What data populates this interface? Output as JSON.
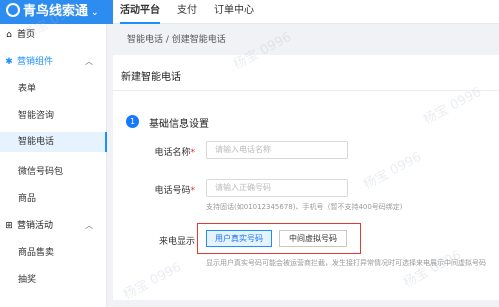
{
  "header": {
    "logo_text": "青鸟线索通",
    "logo_chevron": "⌄",
    "nav": [
      {
        "label": "活动平台",
        "active": true
      },
      {
        "label": "支付"
      },
      {
        "label": "订单中心"
      }
    ]
  },
  "sidebar": {
    "items": [
      {
        "label": "首页",
        "icon": "home-icon",
        "glyph": "⌂"
      },
      {
        "label": "营销组件",
        "icon": "component-icon",
        "glyph": "✱",
        "arrow": "︿"
      },
      {
        "label": "表单"
      },
      {
        "label": "智能咨询"
      },
      {
        "label": "智能电话"
      },
      {
        "label": "微信号码包"
      },
      {
        "label": "商品"
      },
      {
        "label": "营销活动",
        "icon": "activity-icon",
        "glyph": "⊞",
        "arrow": "︿"
      },
      {
        "label": "商品售卖"
      },
      {
        "label": "抽奖"
      }
    ]
  },
  "breadcrumb": "智能电话 / 创建智能电话",
  "page_title": "新建智能电话",
  "section": {
    "step": "1",
    "title": "基础信息设置"
  },
  "form": {
    "phone_name": {
      "label": "电话名称",
      "required": "*",
      "placeholder": "请输入电话名称"
    },
    "phone_number": {
      "label": "电话号码",
      "required": "*",
      "placeholder": "请输入正确号码",
      "hint": "支持固话(如01012345678)、手机号（暂不支持400号码绑定)"
    },
    "caller_display": {
      "label": "来电显示",
      "options": [
        {
          "label": "用户真实号码",
          "selected": true
        },
        {
          "label": "中间虚拟号码",
          "selected": false
        }
      ],
      "hint": "显示用户真实号码可能会被运营商拦截，发生接打异常情况时可选择来电展示中间虚拟号码"
    }
  },
  "watermark": "杨宝 0996"
}
